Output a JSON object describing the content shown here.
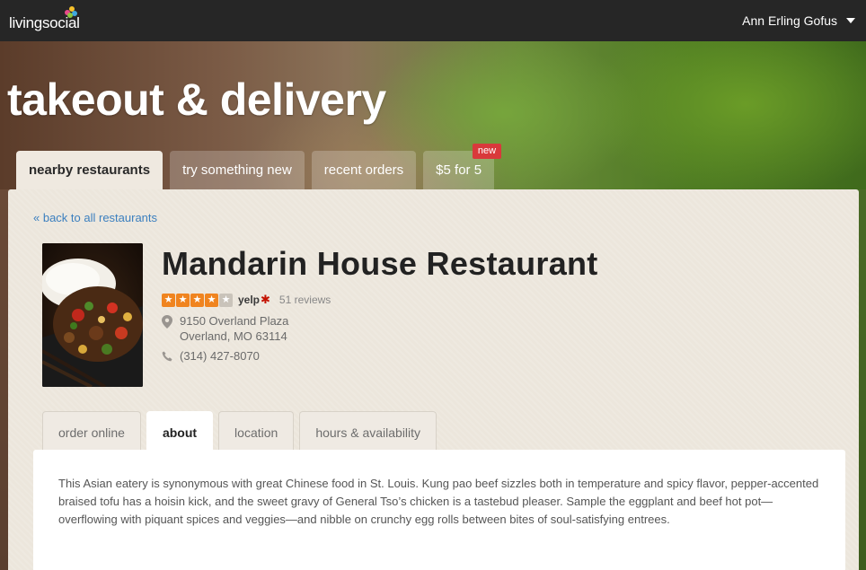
{
  "header": {
    "logo_text": "livingsocial",
    "user_name": "Ann Erling Gofus"
  },
  "hero": {
    "title": "takeout & delivery"
  },
  "main_tabs": [
    {
      "label": "nearby restaurants",
      "active": true
    },
    {
      "label": "try something new",
      "active": false
    },
    {
      "label": "recent orders",
      "active": false
    },
    {
      "label": "$5 for 5",
      "active": false,
      "badge": "new"
    }
  ],
  "restaurant": {
    "back_link": "« back to all restaurants",
    "name": "Mandarin House Restaurant",
    "rating": {
      "stars": 4,
      "max": 5,
      "source": "yelp",
      "reviews": "51 reviews"
    },
    "address_line1": "9150 Overland Plaza",
    "address_line2": "Overland, MO 63114",
    "phone": "(314) 427-8070"
  },
  "sub_tabs": [
    {
      "label": "order online",
      "active": false
    },
    {
      "label": "about",
      "active": true
    },
    {
      "label": "location",
      "active": false
    },
    {
      "label": "hours & availability",
      "active": false
    }
  ],
  "about": {
    "text": "This Asian eatery is synonymous with great Chinese food in St. Louis. Kung pao beef sizzles both in temperature and spicy flavor, pepper-accented braised tofu has a hoisin kick, and the sweet gravy of General Tso’s chicken is a tastebud pleaser. Sample the eggplant and beef hot pot—overflowing with piquant spices and veggies—and nibble on crunchy egg rolls between bites of soul-satisfying entrees."
  },
  "colors": {
    "topbar": "#262626",
    "link": "#3b7fbf",
    "star": "#f0841f",
    "badge": "#d9393b"
  }
}
